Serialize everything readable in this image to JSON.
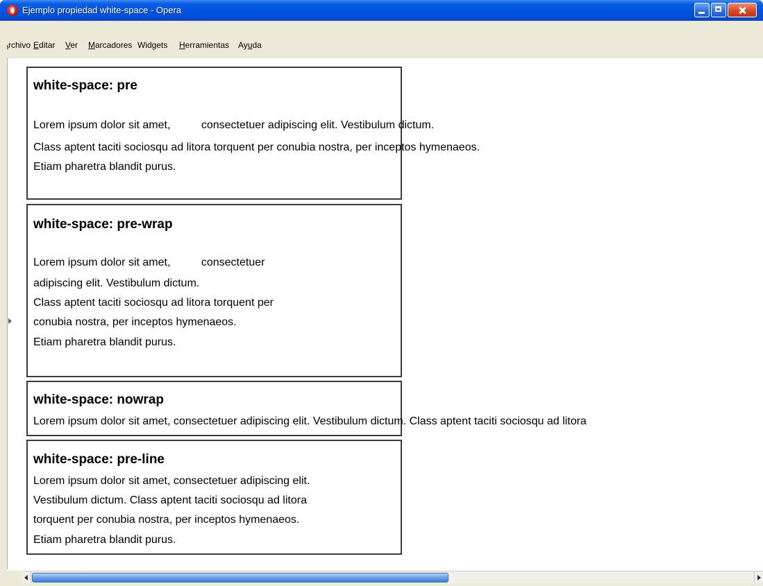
{
  "window": {
    "title": "Ejemplo propiedad white-space - Opera"
  },
  "menu": [
    {
      "u": "A",
      "rest": "rchivo"
    },
    {
      "u": "E",
      "rest": "ditar"
    },
    {
      "u": "V",
      "rest": "er"
    },
    {
      "u": "M",
      "rest": "arcadores"
    },
    {
      "pre": "Widgets",
      "u": "",
      "rest": ""
    },
    {
      "u": "H",
      "rest": "erramientas"
    },
    {
      "pre": "Ay",
      "u": "u",
      "rest": "da"
    }
  ],
  "boxes": {
    "pre": {
      "title": "white-space: pre",
      "lines": [
        "Lorem ipsum dolor sit amet,          consectetuer adipiscing elit. Vestibulum dictum.",
        "Class aptent taciti sociosqu ad litora torquent per conubia nostra, per inceptos hymenaeos.",
        "Etiam pharetra blandit purus."
      ]
    },
    "pre_wrap": {
      "title": "white-space: pre-wrap",
      "lines": [
        "Lorem ipsum dolor sit amet,          consectetuer",
        "adipiscing elit. Vestibulum dictum.",
        "Class aptent taciti sociosqu ad litora torquent per",
        "conubia nostra, per inceptos hymenaeos.",
        "Etiam pharetra blandit purus."
      ]
    },
    "nowrap": {
      "title": "white-space: nowrap",
      "lines": [
        "Lorem ipsum dolor sit amet, consectetuer adipiscing elit. Vestibulum dictum. Class aptent taciti sociosqu ad litora"
      ]
    },
    "pre_line": {
      "title": "white-space: pre-line",
      "lines": [
        "Lorem ipsum dolor sit amet, consectetuer adipiscing elit.",
        "Vestibulum dictum. Class aptent taciti sociosqu ad litora",
        "torquent per conubia nostra, per inceptos hymenaeos.",
        "Etiam pharetra blandit purus."
      ]
    }
  }
}
